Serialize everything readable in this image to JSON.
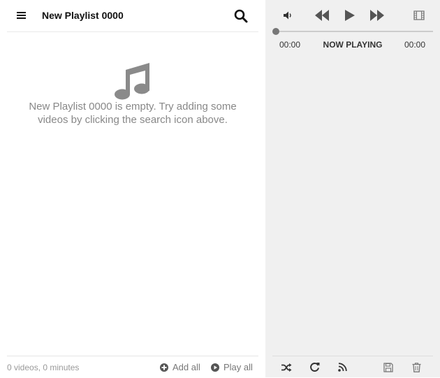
{
  "playlist": {
    "title": "New Playlist 0000",
    "empty_message": "New Playlist 0000 is empty. Try adding some videos by clicking the search icon above.",
    "summary": "0 videos, 0 minutes",
    "add_all_label": "Add all",
    "play_all_label": "Play all"
  },
  "player": {
    "elapsed": "00:00",
    "status": "NOW PLAYING",
    "total": "00:00",
    "progress": 0
  },
  "icons": {
    "menu": "menu-icon",
    "search": "search-icon",
    "empty": "music-note-icon",
    "add": "plus-circle-icon",
    "play_all": "play-circle-icon",
    "volume": "volume-icon",
    "rewind": "rewind-icon",
    "play": "play-icon",
    "fast_forward": "fast-forward-icon",
    "video": "film-icon",
    "shuffle": "shuffle-icon",
    "repeat": "repeat-icon",
    "rss": "rss-icon",
    "save": "save-icon",
    "trash": "trash-icon"
  },
  "colors": {
    "left_bg": "#ffffff",
    "right_bg": "#f0f0f0",
    "icon_dark": "#555555",
    "muted_text": "#888888"
  }
}
